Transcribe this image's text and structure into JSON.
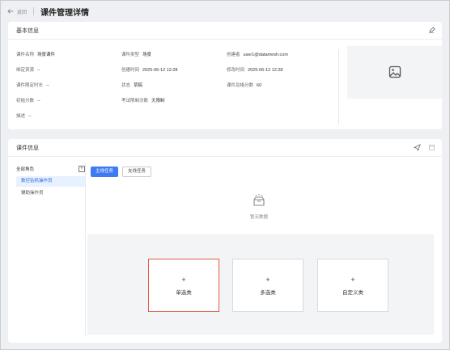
{
  "header": {
    "back_label": "返回",
    "title": "课件管理详情"
  },
  "basic": {
    "title": "基本信息",
    "fields": [
      {
        "key": "课件名称",
        "value": "场景课件"
      },
      {
        "key": "课件类型",
        "value": "场景"
      },
      {
        "key": "创建者",
        "value": "user1@datamesh.com"
      },
      {
        "key": "绑定资源",
        "value": "--"
      },
      {
        "key": "创建时间",
        "value": "2025-06-12 12:28"
      },
      {
        "key": "修改时间",
        "value": "2025-06-12 12:28"
      },
      {
        "key": "课件限定时长",
        "value": "--"
      },
      {
        "key": "状态",
        "value": "草稿"
      },
      {
        "key": "课件及格分数",
        "value": "60"
      },
      {
        "key": "初始分数",
        "value": "--"
      },
      {
        "key": "考试限制次数",
        "value": "无限制"
      },
      {
        "key": "描述",
        "value": "--"
      }
    ]
  },
  "courseware": {
    "title": "课件信息",
    "roles_title": "全部角色",
    "roles": [
      "数控钻机操作员",
      "辅助操作员"
    ],
    "tabs": [
      "主线任务",
      "支线任务"
    ],
    "empty_text": "暂无数据",
    "options": [
      "单选类",
      "多选类",
      "自定义类"
    ]
  },
  "colors": {
    "accent": "#3d7cf0",
    "selected_border": "#e05a44"
  }
}
